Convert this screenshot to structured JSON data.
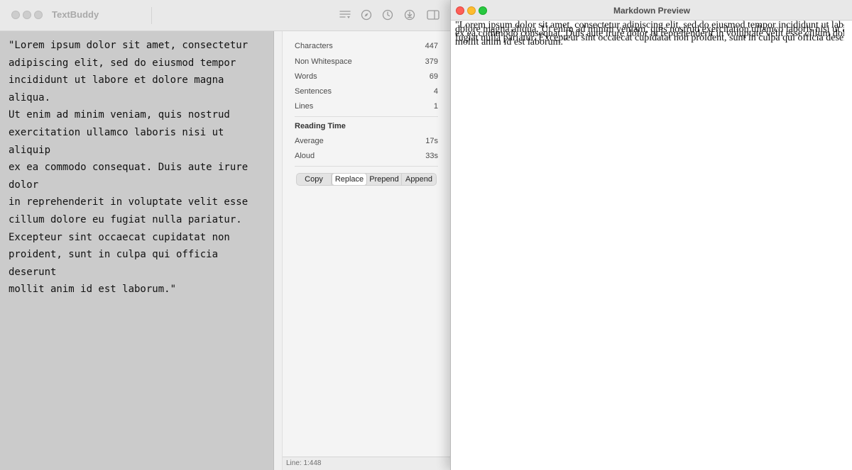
{
  "textbuddy": {
    "title": "TextBuddy",
    "toolbar_icons": [
      "filter-lines-icon",
      "compass-icon",
      "clock-icon",
      "download-icon",
      "sidebar-icon"
    ],
    "editor_text": "\"Lorem ipsum dolor sit amet, consectetur\nadipiscing elit, sed do eiusmod tempor\nincididunt ut labore et dolore magna aliqua.\nUt enim ad minim veniam, quis nostrud\nexercitation ullamco laboris nisi ut aliquip\nex ea commodo consequat. Duis aute irure dolor\nin reprehenderit in voluptate velit esse\ncillum dolore eu fugiat nulla pariatur.\nExcepteur sint occaecat cupidatat non\nproident, sunt in culpa qui officia deserunt\nmollit anim id est laborum.\"",
    "stats": [
      {
        "label": "Characters",
        "value": "447"
      },
      {
        "label": "Non Whitespace",
        "value": "379"
      },
      {
        "label": "Words",
        "value": "69"
      },
      {
        "label": "Sentences",
        "value": "4"
      },
      {
        "label": "Lines",
        "value": "1"
      }
    ],
    "reading_time": {
      "header": "Reading Time",
      "rows": [
        {
          "label": "Average",
          "value": "17s"
        },
        {
          "label": "Aloud",
          "value": "33s"
        }
      ]
    },
    "actions": [
      "Copy",
      "Replace",
      "Prepend",
      "Append"
    ],
    "selected_action": "Replace",
    "status": "Line: 1:448"
  },
  "preview": {
    "title": "Markdown Preview",
    "lines": [
      "\"Lorem ipsum dolor sit amet, consectetur adipiscing elit, sed do eiusmod tempor incididunt ut labore et",
      "dolore magna aliqua. Ut enim ad minim veniam, quis nostrud exercitation ullamco laboris nisi ut aliquip",
      "ex ea commodo consequat. Duis aute irure dolor in reprehenderit in voluptate velit esse cillum dolore eu",
      "fugiat nulla pariatur. Excepteur sint occaecat cupidatat non proident, sunt in culpa qui officia deserunt",
      "mollit anim id est laborum.\""
    ]
  },
  "colors": {
    "close": "#fe5f57",
    "minimize": "#febc2e",
    "zoom": "#28c840",
    "editor_bg": "#cbcbcb"
  }
}
